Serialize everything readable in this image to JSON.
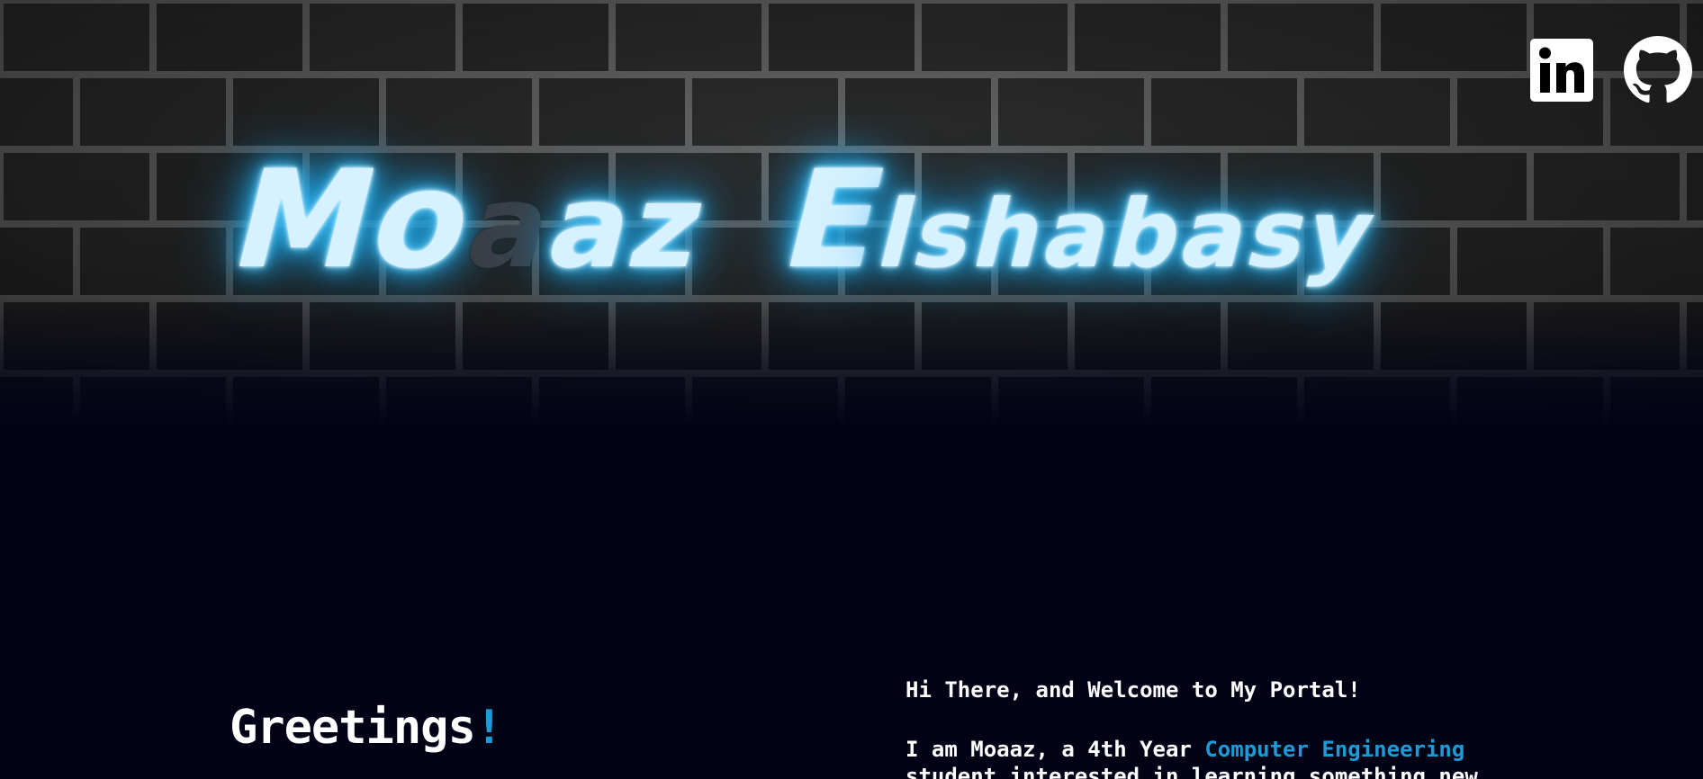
{
  "hero": {
    "first_name": {
      "part1": "Mo",
      "part2": "a",
      "part3": "az"
    },
    "last_name": {
      "part1": "E",
      "part2": "lshabasy"
    }
  },
  "social": {
    "linkedin_icon": "linkedin-icon",
    "github_icon": "github-icon"
  },
  "about": {
    "greeting": "Greetings",
    "greeting_mark": "!",
    "welcome": "Hi There, and Welcome to My Portal!",
    "intro_prefix": "I am Moaaz, a 4th Year ",
    "intro_highlight": "Computer Engineering",
    "intro_continuation": "student interested in learning something new"
  },
  "colors": {
    "background": "#010216",
    "accent": "#1e9bd6",
    "neon": "#31b8f5",
    "text": "#ffffff"
  }
}
